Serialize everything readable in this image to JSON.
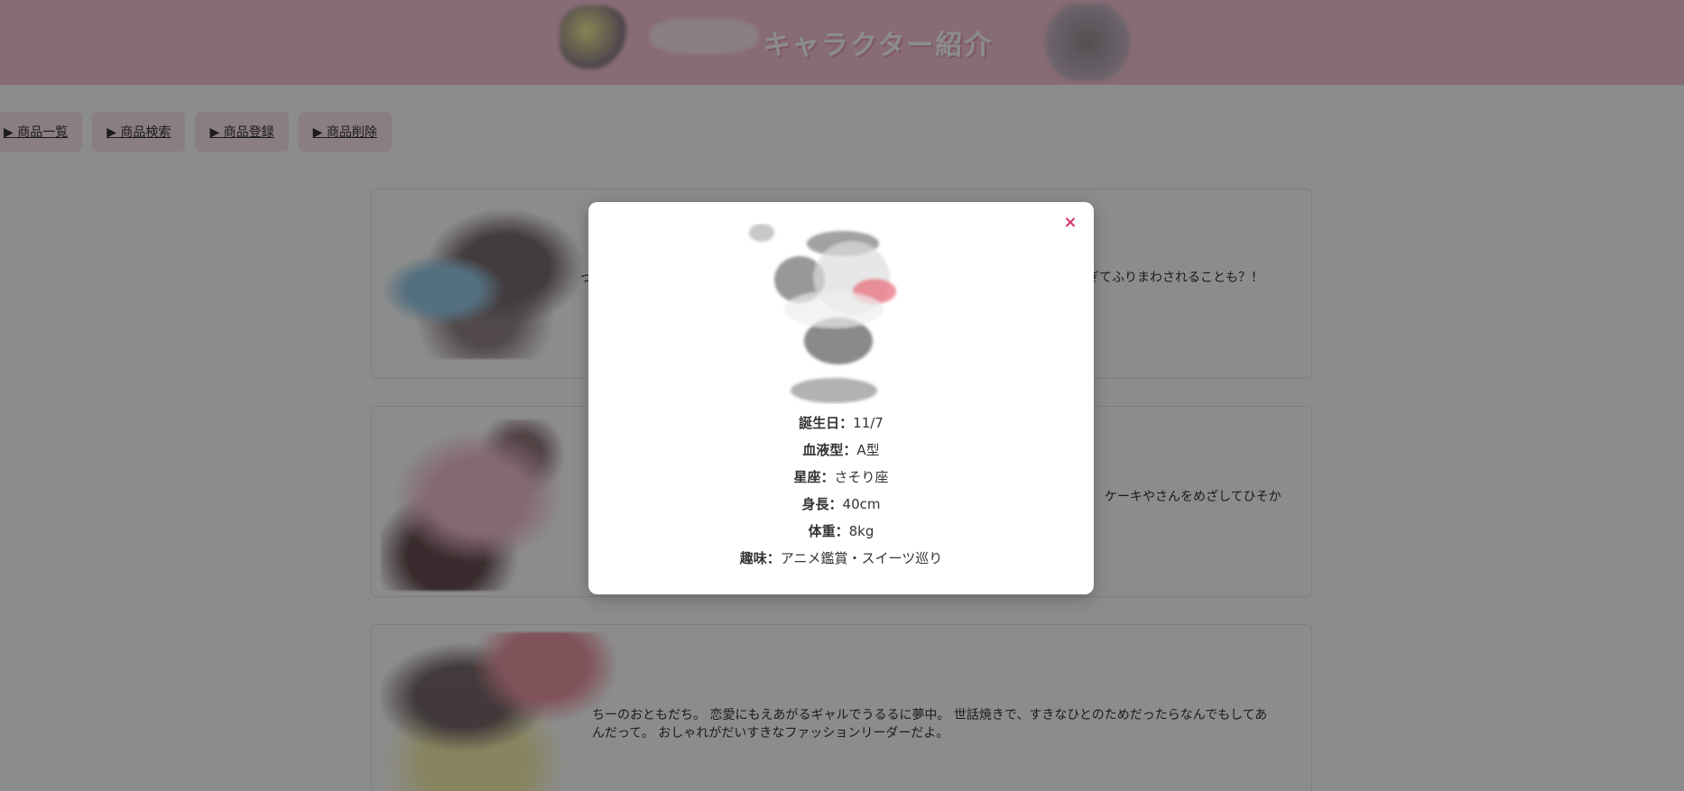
{
  "header": {
    "title": "キャラクター紹介"
  },
  "nav": {
    "items": [
      {
        "label": "▶ 商品一覧"
      },
      {
        "label": "▶ 商品検索"
      },
      {
        "label": "▶ 商品登録"
      },
      {
        "label": "▶ 商品削除"
      }
    ]
  },
  "cards": [
    {
      "text_left": "っ",
      "text_right": "ぎてふりまわされることも？！"
    },
    {
      "text_right": "ケーキやさんをめざしてひそか"
    },
    {
      "text_line1": "ちーのおともだち。 恋愛にもえあがるギャルでうるるに夢中。 世話焼きで、すきなひとのためだったらなんでもしてあ",
      "text_line2": "んだって。 おしゃれがだいすきなファッションリーダーだよ。"
    }
  ],
  "modal": {
    "close_label": "×",
    "profile": [
      {
        "label": "誕生日：",
        "value": "11/7"
      },
      {
        "label": "血液型：",
        "value": "A型"
      },
      {
        "label": "星座：",
        "value": "さそり座"
      },
      {
        "label": "身長：",
        "value": "40cm"
      },
      {
        "label": "体重：",
        "value": "8kg"
      },
      {
        "label": "趣味：",
        "value": "アニメ鑑賞・スイーツ巡り"
      }
    ]
  }
}
